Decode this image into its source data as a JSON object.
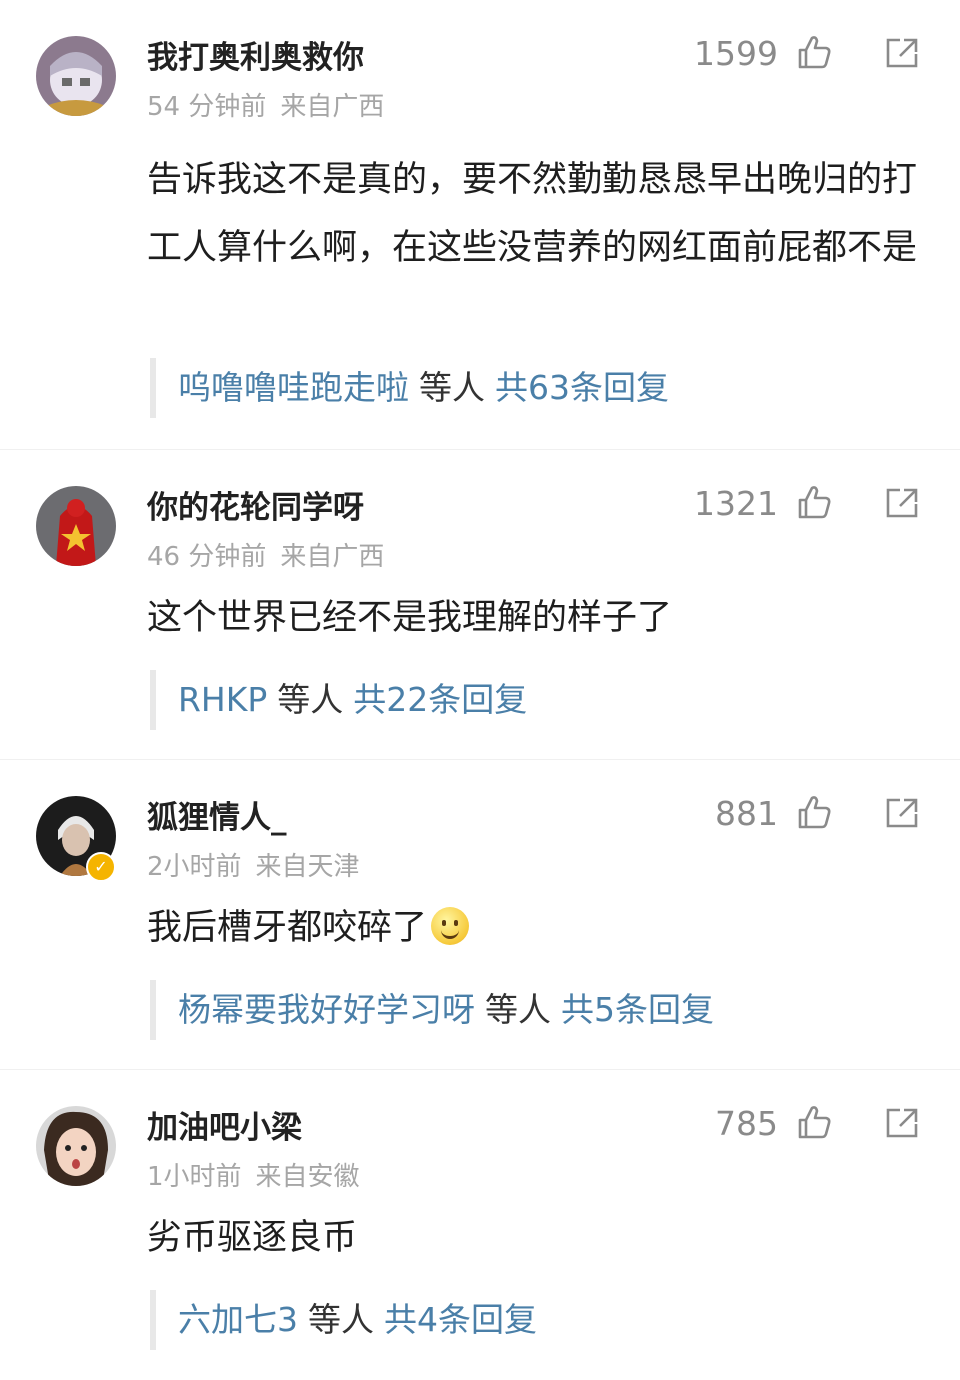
{
  "comments": [
    {
      "username": "我打奥利奥救你",
      "time": "54 分钟前",
      "location": "来自广西",
      "likes": "1599",
      "text": "告诉我这不是真的，要不然勤勤恳恳早出晚归的打工人算什么啊，在这些没营养的网红面前屁都不是",
      "reply_names": "呜噜噜哇跑走啦",
      "reply_mid": "等人",
      "reply_count": "共63条回复"
    },
    {
      "username": "你的花轮同学呀",
      "time": "46 分钟前",
      "location": "来自广西",
      "likes": "1321",
      "text": "这个世界已经不是我理解的样子了",
      "reply_names": "RHKP",
      "reply_mid": "等人",
      "reply_count": "共22条回复"
    },
    {
      "username": "狐狸情人_",
      "time": "2小时前",
      "location": "来自天津",
      "likes": "881",
      "text": "我后槽牙都咬碎了",
      "reply_names": "杨幂要我好好学习呀",
      "reply_mid": "等人",
      "reply_count": "共5条回复"
    },
    {
      "username": "加油吧小梁",
      "time": "1小时前",
      "location": "来自安徽",
      "likes": "785",
      "text": "劣币驱逐良币",
      "reply_names": "六加七3",
      "reply_mid": "等人",
      "reply_count": "共4条回复"
    }
  ],
  "icons": {
    "like": "thumbs-up-outline-icon",
    "share": "share-external-icon",
    "verified": "verified-badge-icon",
    "emoji": "smiley-emoji-icon"
  },
  "colors": {
    "link": "#4a7fa8",
    "meta": "#a6a6a6",
    "likes": "#8a8a8a",
    "verified": "#f5b400"
  }
}
